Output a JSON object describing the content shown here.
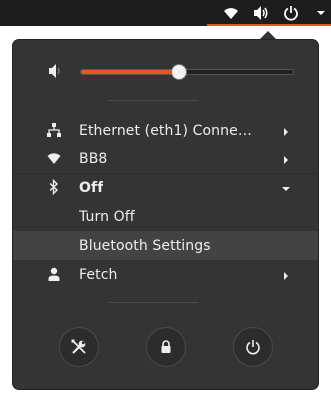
{
  "top_panel": {
    "icons": [
      "wifi-icon",
      "volume-icon",
      "power-icon",
      "chevron-down-icon"
    ],
    "accent_color": "#e95420"
  },
  "volume": {
    "level_percent": 46,
    "icon": "volume-low-icon"
  },
  "network_items": [
    {
      "label": "Ethernet (eth1) Connect...",
      "icon": "ethernet-icon",
      "submenu": true
    },
    {
      "label": "BB8",
      "icon": "wifi-icon",
      "submenu": true
    }
  ],
  "bluetooth": {
    "label": "Off",
    "icon": "bluetooth-icon",
    "expanded": true,
    "items": [
      {
        "label": "Turn Off"
      },
      {
        "label": "Bluetooth Settings"
      }
    ]
  },
  "user": {
    "label": "Fetch",
    "icon": "user-icon",
    "submenu": true
  },
  "actions": [
    {
      "name": "settings",
      "icon": "settings-icon"
    },
    {
      "name": "lock",
      "icon": "lock-icon"
    },
    {
      "name": "power-off",
      "icon": "power-icon"
    }
  ],
  "colors": {
    "menu_bg": "#343434",
    "accent": "#e95420",
    "highlight": "#434343"
  }
}
